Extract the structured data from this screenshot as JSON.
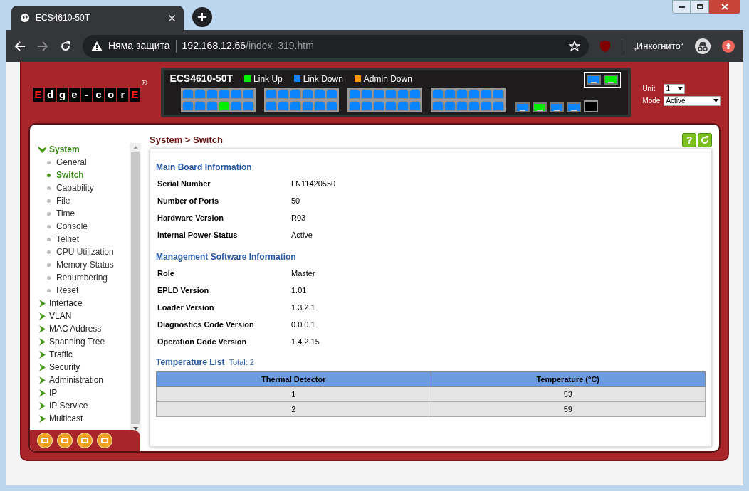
{
  "browser": {
    "tab_title": "ECS4610-50T",
    "security": "Няма защита",
    "url_host": "192.168.12.66",
    "url_path": "/index_319.htm",
    "profile": "„Инкогнито“"
  },
  "header": {
    "logo": [
      {
        "letter": "E",
        "highlighted": true
      },
      {
        "letter": "d",
        "highlighted": false
      },
      {
        "letter": "g",
        "highlighted": false
      },
      {
        "letter": "e",
        "highlighted": false
      },
      {
        "letter": "-",
        "highlighted": false
      },
      {
        "letter": "c",
        "highlighted": false
      },
      {
        "letter": "o",
        "highlighted": false
      },
      {
        "letter": "r",
        "highlighted": false
      },
      {
        "letter": "E",
        "highlighted": true
      }
    ],
    "logo_mark": "®",
    "model": "ECS4610-50T",
    "legend": [
      {
        "label": "Link Up",
        "color": "#00ee00"
      },
      {
        "label": "Link Down",
        "color": "#0a84ff"
      },
      {
        "label": "Admin Down",
        "color": "#ff9900"
      }
    ],
    "port_groups": [
      {
        "ports": [
          {
            "link_up": false
          },
          {
            "link_up": false
          },
          {
            "link_up": false
          },
          {
            "link_up": false
          },
          {
            "link_up": false
          },
          {
            "link_up": false
          },
          {
            "link_up": false
          },
          {
            "link_up": false
          },
          {
            "link_up": false
          },
          {
            "link_up": true
          },
          {
            "link_up": false
          },
          {
            "link_up": false
          }
        ]
      },
      {
        "ports": [
          {
            "link_up": false
          },
          {
            "link_up": false
          },
          {
            "link_up": false
          },
          {
            "link_up": false
          },
          {
            "link_up": false
          },
          {
            "link_up": false
          },
          {
            "link_up": false
          },
          {
            "link_up": false
          },
          {
            "link_up": false
          },
          {
            "link_up": false
          },
          {
            "link_up": false
          },
          {
            "link_up": false
          }
        ]
      },
      {
        "ports": [
          {
            "link_up": false
          },
          {
            "link_up": false
          },
          {
            "link_up": false
          },
          {
            "link_up": false
          },
          {
            "link_up": false
          },
          {
            "link_up": false
          },
          {
            "link_up": false
          },
          {
            "link_up": false
          },
          {
            "link_up": false
          },
          {
            "link_up": false
          },
          {
            "link_up": false
          },
          {
            "link_up": false
          }
        ]
      },
      {
        "ports": [
          {
            "link_up": false
          },
          {
            "link_up": false
          },
          {
            "link_up": false
          },
          {
            "link_up": false
          },
          {
            "link_up": false
          },
          {
            "link_up": false
          },
          {
            "link_up": false
          },
          {
            "link_up": false
          },
          {
            "link_up": false
          },
          {
            "link_up": false
          },
          {
            "link_up": false
          },
          {
            "link_up": false
          }
        ]
      }
    ],
    "sfp_ports": [
      {
        "link_up": false
      },
      {
        "link_up": true
      },
      {
        "link_up": false
      },
      {
        "link_up": false
      }
    ],
    "top_sfp_ports": [
      {
        "link_up": false
      },
      {
        "link_up": true
      }
    ],
    "help_label": "?",
    "unit": {
      "label": "Unit",
      "value": "1"
    },
    "mode": {
      "label": "Mode",
      "value": "Active"
    }
  },
  "sidebar": {
    "items": [
      {
        "label": "System",
        "expanded": true,
        "children": [
          {
            "label": "General",
            "selected": false
          },
          {
            "label": "Switch",
            "selected": true
          },
          {
            "label": "Capability",
            "selected": false
          },
          {
            "label": "File",
            "selected": false
          },
          {
            "label": "Time",
            "selected": false
          },
          {
            "label": "Console",
            "selected": false
          },
          {
            "label": "Telnet",
            "selected": false
          },
          {
            "label": "CPU Utilization",
            "selected": false
          },
          {
            "label": "Memory Status",
            "selected": false
          },
          {
            "label": "Renumbering",
            "selected": false
          },
          {
            "label": "Reset",
            "selected": false
          }
        ]
      },
      {
        "label": "Interface",
        "expanded": false
      },
      {
        "label": "VLAN",
        "expanded": false
      },
      {
        "label": "MAC Address",
        "expanded": false
      },
      {
        "label": "Spanning Tree",
        "expanded": false
      },
      {
        "label": "Traffic",
        "expanded": false
      },
      {
        "label": "Security",
        "expanded": false
      },
      {
        "label": "Administration",
        "expanded": false
      },
      {
        "label": "IP",
        "expanded": false
      },
      {
        "label": "IP Service",
        "expanded": false
      },
      {
        "label": "Multicast",
        "expanded": false
      }
    ]
  },
  "breadcrumb": "System > Switch",
  "sections": [
    {
      "title": "Main Board Information",
      "rows": [
        {
          "label": "Serial Number",
          "value": "LN11420550"
        },
        {
          "label": "Number of Ports",
          "value": "50"
        },
        {
          "label": "Hardware Version",
          "value": "R03"
        },
        {
          "label": "Internal Power Status",
          "value": "Active"
        }
      ]
    },
    {
      "title": "Management Software Information",
      "rows": [
        {
          "label": "Role",
          "value": "Master"
        },
        {
          "label": "EPLD Version",
          "value": "1.01"
        },
        {
          "label": "Loader Version",
          "value": "1.3.2.1"
        },
        {
          "label": "Diagnostics Code Version",
          "value": "0.0.0.1"
        },
        {
          "label": "Operation Code Version",
          "value": "1.4.2.15"
        }
      ]
    }
  ],
  "temperature": {
    "title": "Temperature List",
    "total": "Total: 2",
    "columns": [
      "Thermal Detector",
      "Temperature (°C)"
    ],
    "rows": [
      [
        "1",
        "53"
      ],
      [
        "2",
        "59"
      ]
    ]
  }
}
